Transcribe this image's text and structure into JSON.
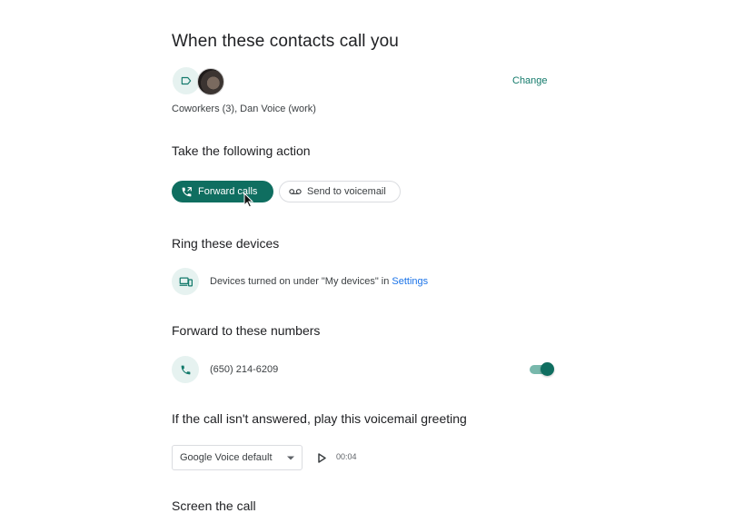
{
  "contacts_section": {
    "title": "When these contacts call you",
    "change_label": "Change",
    "contacts_text": "Coworkers (3), Dan Voice (work)"
  },
  "action_section": {
    "title": "Take the following action",
    "forward_label": "Forward calls",
    "voicemail_label": "Send to voicemail"
  },
  "ring_section": {
    "title": "Ring these devices",
    "devices_text": "Devices turned on under \"My devices\" in",
    "settings_link": "Settings"
  },
  "forward_section": {
    "title": "Forward to these numbers",
    "number": "(650) 214-6209",
    "toggle_on": true
  },
  "voicemail_section": {
    "title": "If the call isn't answered, play this voicemail greeting",
    "greeting_selected": "Google Voice default",
    "duration": "00:04"
  },
  "screen_section": {
    "title": "Screen the call"
  },
  "colors": {
    "accent": "#0f6e60",
    "accent_light": "#e6f2f0",
    "link_blue": "#1a73e8"
  },
  "icons": [
    "label-icon",
    "avatar",
    "forward-call-icon",
    "voicemail-icon",
    "devices-icon",
    "phone-icon",
    "chevron-down-icon",
    "play-icon",
    "mouse-cursor"
  ]
}
